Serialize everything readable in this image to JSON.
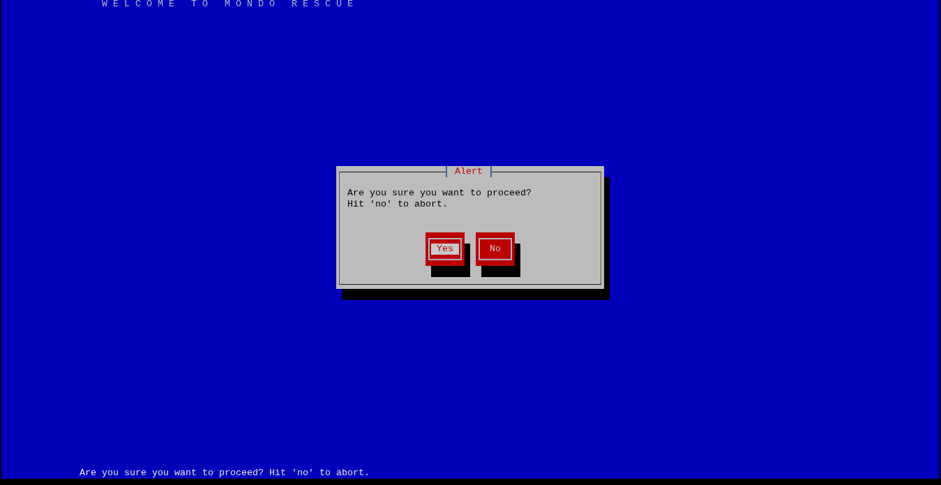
{
  "header": {
    "title": "WELCOME TO MONDO RESCUE"
  },
  "dialog": {
    "title": "Alert",
    "message": [
      "Are you sure you want to proceed?",
      "Hit 'no' to abort."
    ],
    "buttons": [
      {
        "label": "Yes",
        "selected": true
      },
      {
        "label": "No",
        "selected": false
      }
    ]
  },
  "status_bar": {
    "text": "Are you sure you want to proceed? Hit 'no' to abort."
  }
}
